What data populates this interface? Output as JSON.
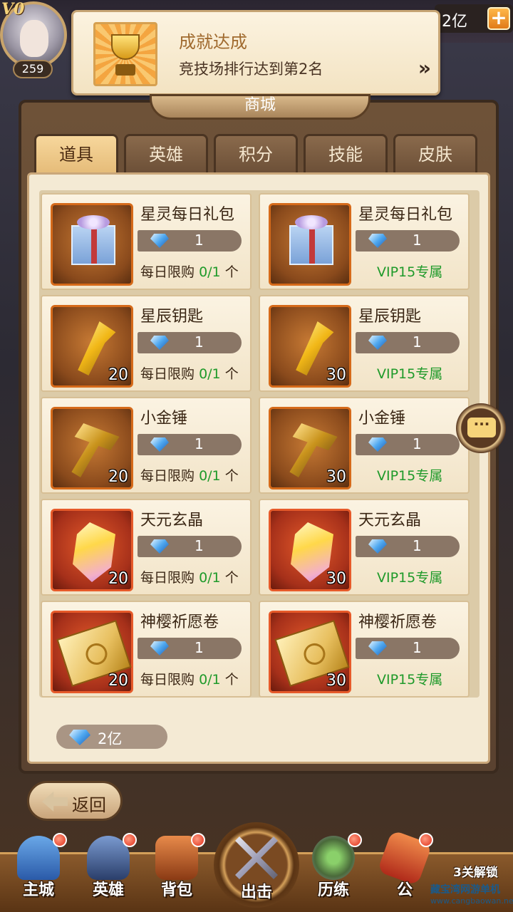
{
  "player": {
    "vip_label": "V0",
    "level": "259"
  },
  "currency_top": {
    "value": "2亿"
  },
  "toast": {
    "title": "成就达成",
    "description": "竞技场排行达到第2名",
    "arrow": "»"
  },
  "shop": {
    "title": "商城",
    "tabs": [
      {
        "label": "道具",
        "active": true
      },
      {
        "label": "英雄",
        "active": false
      },
      {
        "label": "积分",
        "active": false
      },
      {
        "label": "技能",
        "active": false
      },
      {
        "label": "皮肤",
        "active": false
      }
    ],
    "items": [
      {
        "name": "星灵每日礼包",
        "price": "1",
        "qty": "",
        "limit_prefix": "每日限购",
        "limit_value": "0/1",
        "limit_suffix": "个",
        "icon": "gift-box-icon"
      },
      {
        "name": "星灵每日礼包",
        "price": "1",
        "qty": "",
        "vip": "VIP15专属",
        "icon": "gift-box-icon"
      },
      {
        "name": "星辰钥匙",
        "price": "1",
        "qty": "20",
        "limit_prefix": "每日限购",
        "limit_value": "0/1",
        "limit_suffix": "个",
        "icon": "star-key-icon"
      },
      {
        "name": "星辰钥匙",
        "price": "1",
        "qty": "30",
        "vip": "VIP15专属",
        "icon": "star-key-icon"
      },
      {
        "name": "小金锤",
        "price": "1",
        "qty": "20",
        "limit_prefix": "每日限购",
        "limit_value": "0/1",
        "limit_suffix": "个",
        "icon": "gold-hammer-icon"
      },
      {
        "name": "小金锤",
        "price": "1",
        "qty": "30",
        "vip": "VIP15专属",
        "icon": "gold-hammer-icon"
      },
      {
        "name": "天元玄晶",
        "price": "1",
        "qty": "20",
        "limit_prefix": "每日限购",
        "limit_value": "0/1",
        "limit_suffix": "个",
        "icon": "crystal-icon"
      },
      {
        "name": "天元玄晶",
        "price": "1",
        "qty": "30",
        "vip": "VIP15专属",
        "icon": "crystal-icon"
      },
      {
        "name": "神樱祈愿卷",
        "price": "1",
        "qty": "20",
        "limit_prefix": "每日限购",
        "limit_value": "0/1",
        "limit_suffix": "个",
        "icon": "wish-scroll-icon"
      },
      {
        "name": "神樱祈愿卷",
        "price": "1",
        "qty": "30",
        "vip": "VIP15专属",
        "icon": "wish-scroll-icon"
      }
    ],
    "balance": "2亿"
  },
  "chat": {
    "glyph": "···"
  },
  "back_button": {
    "label": "返回"
  },
  "nav": {
    "items": [
      {
        "label": "主城",
        "has_dot": true
      },
      {
        "label": "英雄",
        "has_dot": true
      },
      {
        "label": "背包",
        "has_dot": true
      },
      {
        "label": "出击",
        "has_dot": false
      },
      {
        "label": "历练",
        "has_dot": true
      },
      {
        "label": "公",
        "has_dot": true
      }
    ],
    "unlock_text": "3关解锁"
  },
  "watermark": {
    "text": "藏宝湾网游单机",
    "url": "www.cangbaowan.net"
  },
  "colors": {
    "accent_orange": "#e07a18",
    "limit_green": "#1f9a2a",
    "panel_bg": "#f4ead4",
    "frame_brown": "#5a4230"
  }
}
